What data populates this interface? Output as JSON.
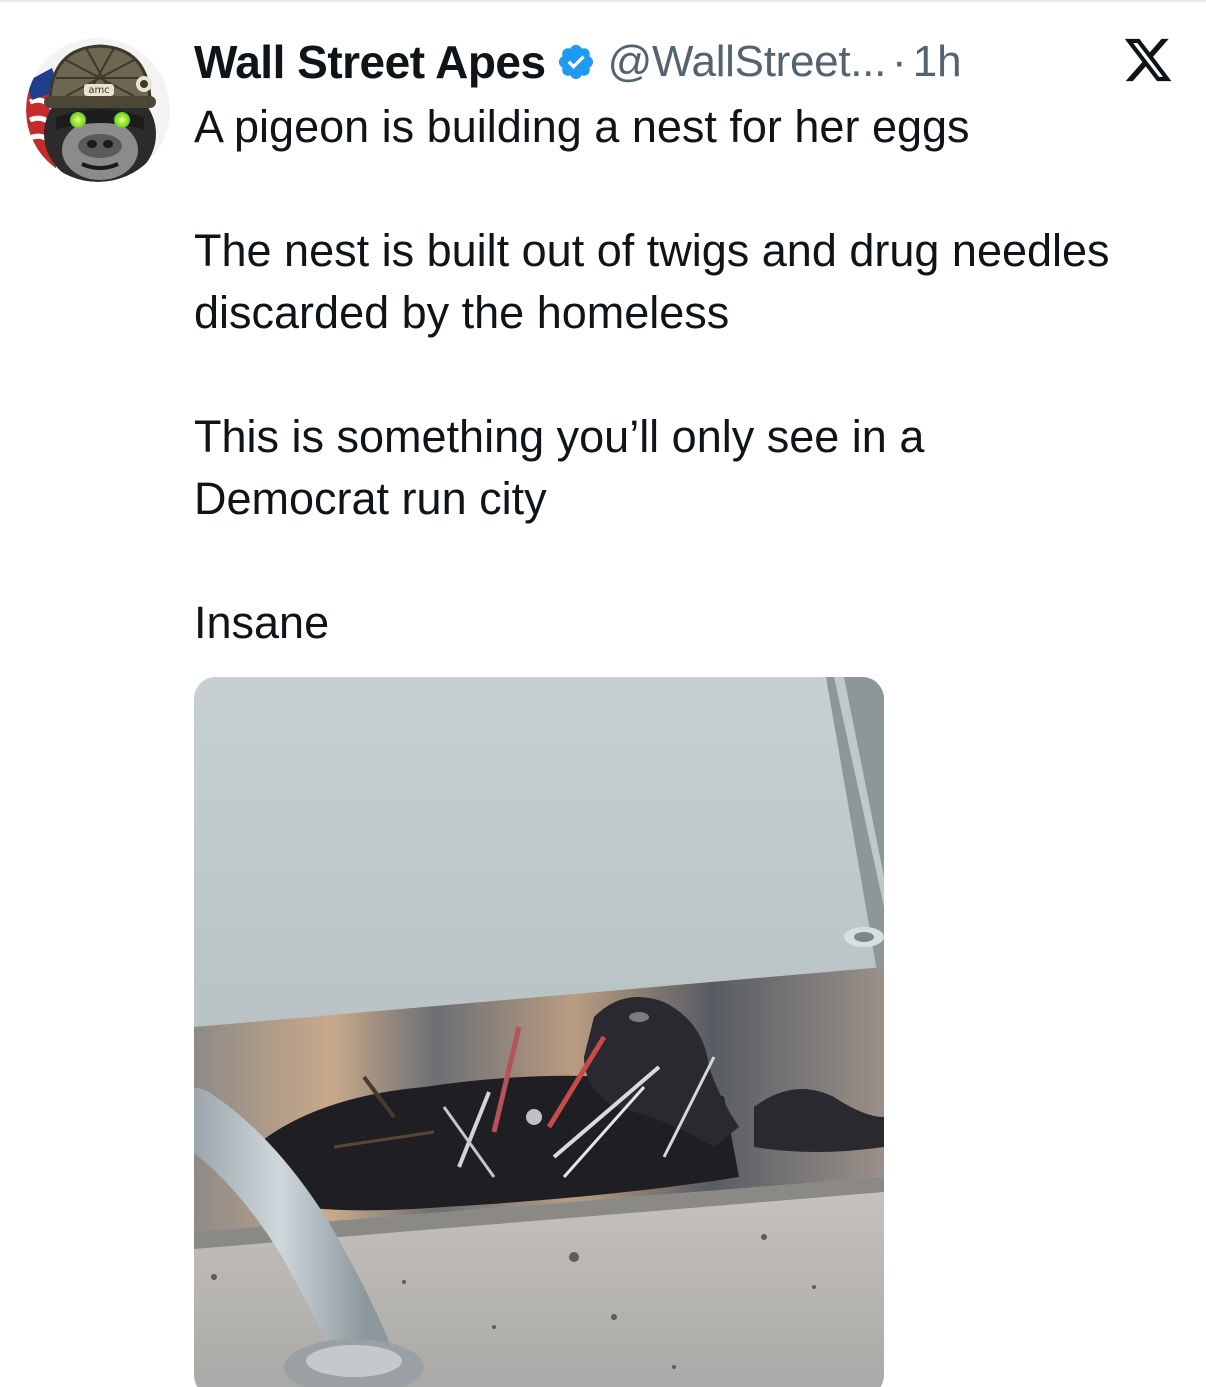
{
  "author": {
    "display_name": "Wall Street Apes",
    "handle": "@WallStreet...",
    "separator": "·",
    "timestamp": "1h",
    "verified": true,
    "avatar_icon": "gorilla-helmet-avatar",
    "avatar_helmet_text": "amc"
  },
  "brand": {
    "logo_icon": "x-logo-icon"
  },
  "tweet": {
    "paragraphs": [
      [
        "A pigeon is building a nest for her eggs"
      ],
      [
        "The nest is built out of twigs and drug needles",
        "discarded by the homeless"
      ],
      [
        "This is something you’ll only see in a",
        "Democrat run city"
      ],
      [
        "Insane"
      ]
    ]
  },
  "media": {
    "type": "photo",
    "description_icon": "pigeon-nest-photo"
  },
  "colors": {
    "text_primary": "#0f1419",
    "text_secondary": "#536471",
    "verified_blue": "#1d9bf0",
    "divider": "#e7e9ea"
  }
}
